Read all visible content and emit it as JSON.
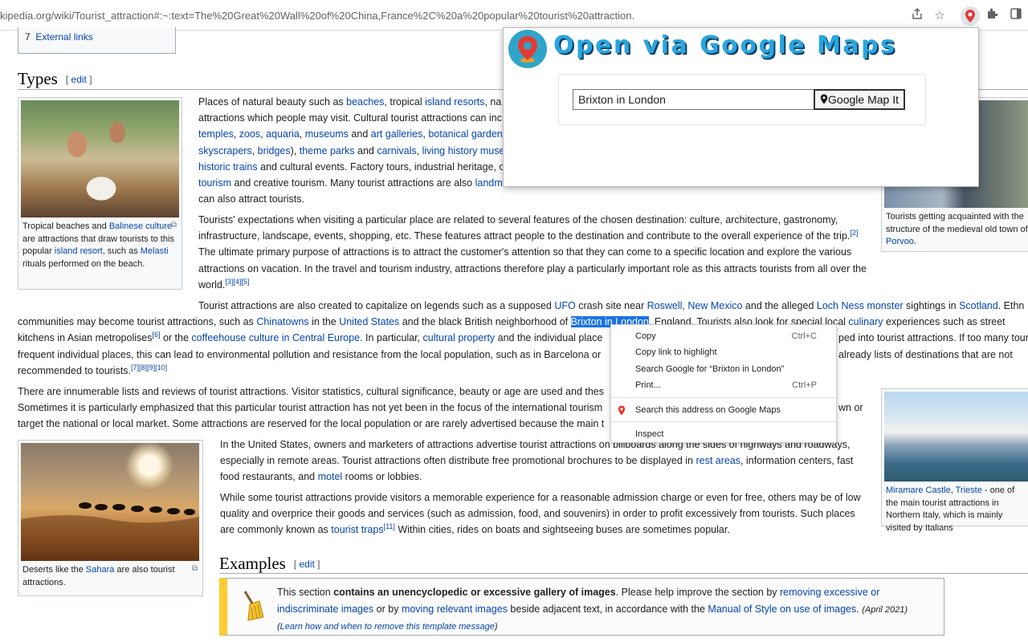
{
  "browser": {
    "url": "kipedia.org/wiki/Tourist_attraction#:~:text=The%20Great%20Wall%20of%20China,France%2C%20a%20popular%20tourist%20attraction."
  },
  "toc": {
    "number": "7",
    "label": "External links"
  },
  "sections": {
    "types": {
      "title": "Types",
      "edit": "edit"
    },
    "examples": {
      "title": "Examples",
      "edit": "edit"
    }
  },
  "captions": {
    "beach": {
      "t1": "Tropical beaches and ",
      "l1": "Balinese culture",
      "t2": " are attractions that draw tourists to this popular ",
      "l2": "island resort",
      "t3": ", such as ",
      "l3": "Melasti",
      "t4": " rituals performed on the beach."
    },
    "sahara": {
      "t1": "Deserts like the ",
      "l1": "Sahara",
      "t2": " are also tourist attractions."
    },
    "porvoo": {
      "t1": "Tourists getting acquainted with the structure of the medieval old town of ",
      "l1": "Porvoo",
      "t2": "."
    },
    "miramare": {
      "l1": "Miramare Castle",
      "t1": ", ",
      "l2": "Trieste",
      "t2": " - one of the main tourist attractions in Northern Italy, which is mainly visited by Italians"
    }
  },
  "p1": {
    "t1": "Places of natural beauty such as ",
    "l1": "beaches",
    "t2": ", tropical ",
    "l2": "island resorts",
    "t3": ", na",
    "t4": "attractions which people may visit. Cultural tourist attractions can inc",
    "l3": "temples",
    "t5": ", ",
    "l4": "zoos",
    "t6": ", ",
    "l5": "aquaria",
    "t7": ", ",
    "l6": "museums",
    "t8": " and ",
    "l7": "art galleries",
    "t9": ", ",
    "l8": "botanical garden",
    "l9": "skyscrapers",
    "t10": ", ",
    "l10": "bridges",
    "t11": "), ",
    "l11": "theme parks",
    "t12": " and ",
    "l12": "carnivals",
    "t13": ", ",
    "l13": "living history muse",
    "l14": "historic trains",
    "t14": " and cultural events. Factory tours, industrial heritage, c",
    "l15": "tourism",
    "t15": " and creative tourism. Many tourist attractions are also ",
    "l16": "landm",
    "t16": "can also attract tourists."
  },
  "p2": {
    "t1": "Tourists' expectations when visiting a particular place are related to several features of the chosen destination: culture, architecture, gastronomy, infrastructure, landscape, events, shopping, etc. These features attract people to the destination and contribute to the overall experience of the trip.",
    "r1": "[2]",
    "t2": " The ultimate primary purpose of attractions is to attract the customer's attention so that they can come to a specific location and explore the various attractions on vacation. In the travel and tourism industry, attractions therefore play a particularly important role as this attracts tourists from all over the world.",
    "r2": "[3][4][5]"
  },
  "p3": {
    "t1": "Tourist attractions are also created to capitalize on legends such as a supposed ",
    "l1": "UFO",
    "t2": " crash site near ",
    "l2": "Roswell, New Mexico",
    "t3": " and the alleged ",
    "l3": "Loch Ness monster",
    "t4": " sightings in ",
    "l4": "Scotland",
    "t5": ". Ethn",
    "t6": "communities may become tourist attractions, such as ",
    "l5": "Chinatowns",
    "t7": " in the ",
    "l6": "United States",
    "t8": " and the black British neighborhood of ",
    "hl": "Brixton in London",
    "t9": ". England. Tourists also look for special local ",
    "l7": "culinary",
    "t10": " experiences such as street",
    "t11": "kitchens in Asian metropolises",
    "r1": "[6]",
    "t12": " or the ",
    "l8": "coffeehouse culture in Central Europe",
    "t13": ". In particular, ",
    "l9": "cultural property",
    "t14": " and the individual place",
    "t15": "ped into tourist attractions. If too many touris",
    "t16": "frequent individual places, this can lead to environmental pollution and resistance from the local population, such as in Barcelona or",
    "t17": "already lists of destinations that are not",
    "t18": "recommended to tourists.",
    "r2": "[7][8][9][10]"
  },
  "p4": {
    "t1": "There are innumerable lists and reviews of tourist attractions. Visitor statistics, cultural significance, beauty or age are used and thes",
    "t2": "Sometimes it is particularly emphasized that this particular tourist attraction has not yet been in the focus of the international tourism",
    "t3": "wn or",
    "t4": "target the national or local market. Some attractions are reserved for the local population or are rarely advertised because the main t"
  },
  "p5": {
    "t1": "In the United States, owners and marketers of attractions advertise tourist attractions on billboards along the sides of highways and roadways, especially in remote areas. Tourist attractions often distribute free promotional brochures to be displayed in ",
    "l1": "rest areas",
    "t2": ", information centers, fast food restaurants, and ",
    "l2": "motel",
    "t3": " rooms or lobbies."
  },
  "p6": {
    "t1": "While some tourist attractions provide visitors a memorable experience for a reasonable admission charge or even for free, others may be of low quality and overprice their goods and services (such as admission, food, and souvenirs) in order to profit excessively from tourists. Such places are commonly known as ",
    "l1": "tourist traps",
    "r1": "[11]",
    "t2": " Within cities, rides on boats and sightseeing buses are sometimes popular."
  },
  "ambox": {
    "t1": "This section ",
    "b1": "contains an unencyclopedic or excessive gallery of images",
    "t2": ". Please help improve the section by ",
    "l1": "removing excessive or indiscriminate images",
    "t3": " or by ",
    "l2": "moving relevant images",
    "t4": " beside adjacent text, in accordance with the ",
    "l3": "Manual of Style on use of images",
    "t5": ". ",
    "date": "(April 2021)",
    "p1": "(",
    "l4": "Learn how and when to remove this template message",
    "p2": ")"
  },
  "popup": {
    "title": "Open via Google Maps",
    "input_value": "Brixton in London",
    "button_label": "Google Map It",
    "brand_color": "#2aa5e0"
  },
  "context_menu": {
    "items": [
      {
        "label": "Copy",
        "shortcut": "Ctrl+C"
      },
      {
        "label": "Copy link to highlight",
        "shortcut": ""
      },
      {
        "label": "Search Google for “Brixton in London”",
        "shortcut": ""
      },
      {
        "label": "Print...",
        "shortcut": "Ctrl+P"
      },
      {
        "label": "Search this address on Google Maps",
        "shortcut": ""
      },
      {
        "label": "Inspect",
        "shortcut": ""
      }
    ]
  }
}
